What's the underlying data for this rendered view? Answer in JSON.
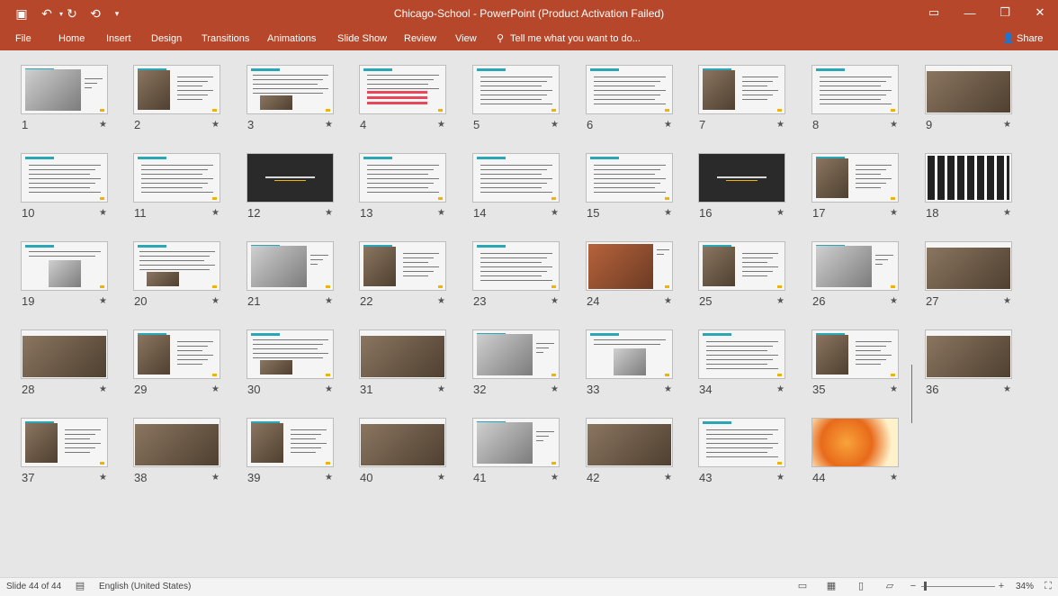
{
  "window": {
    "title": "Chicago-School - PowerPoint (Product Activation Failed)"
  },
  "quick_access": [
    {
      "name": "save-icon",
      "glyph": "💾"
    },
    {
      "name": "undo-icon",
      "glyph": "↶"
    },
    {
      "name": "redo-icon",
      "glyph": "↻"
    },
    {
      "name": "start-from-beginning-icon",
      "glyph": "⟲"
    },
    {
      "name": "customize-qat-icon",
      "glyph": "▾"
    }
  ],
  "ribbon": {
    "tabs": [
      "File",
      "Home",
      "Insert",
      "Design",
      "Transitions",
      "Animations",
      "Slide Show",
      "Review",
      "View"
    ],
    "tell_me": "Tell me what you want to do...",
    "share": "Share"
  },
  "slides": [
    {
      "n": "1",
      "type": "image-grey"
    },
    {
      "n": "2",
      "type": "image-left"
    },
    {
      "n": "3",
      "type": "text-image"
    },
    {
      "n": "4",
      "type": "text-red"
    },
    {
      "n": "5",
      "type": "text"
    },
    {
      "n": "6",
      "type": "text"
    },
    {
      "n": "7",
      "type": "image-left"
    },
    {
      "n": "8",
      "type": "text"
    },
    {
      "n": "9",
      "type": "image-full"
    },
    {
      "n": "10",
      "type": "text"
    },
    {
      "n": "11",
      "type": "text"
    },
    {
      "n": "12",
      "type": "dark"
    },
    {
      "n": "13",
      "type": "text"
    },
    {
      "n": "14",
      "type": "text"
    },
    {
      "n": "15",
      "type": "text"
    },
    {
      "n": "16",
      "type": "dark"
    },
    {
      "n": "17",
      "type": "image-left"
    },
    {
      "n": "18",
      "type": "image-bw"
    },
    {
      "n": "19",
      "type": "image-center"
    },
    {
      "n": "20",
      "type": "text-image"
    },
    {
      "n": "21",
      "type": "image-grey"
    },
    {
      "n": "22",
      "type": "image-left"
    },
    {
      "n": "23",
      "type": "text"
    },
    {
      "n": "24",
      "type": "image-warm"
    },
    {
      "n": "25",
      "type": "image-left"
    },
    {
      "n": "26",
      "type": "image-grey"
    },
    {
      "n": "27",
      "type": "image-full"
    },
    {
      "n": "28",
      "type": "image-full"
    },
    {
      "n": "29",
      "type": "image-left"
    },
    {
      "n": "30",
      "type": "text-image"
    },
    {
      "n": "31",
      "type": "image-full"
    },
    {
      "n": "32",
      "type": "image-grey"
    },
    {
      "n": "33",
      "type": "image-center"
    },
    {
      "n": "34",
      "type": "text"
    },
    {
      "n": "35",
      "type": "image-left"
    },
    {
      "n": "36",
      "type": "image-full"
    },
    {
      "n": "37",
      "type": "image-left"
    },
    {
      "n": "38",
      "type": "image-full"
    },
    {
      "n": "39",
      "type": "image-left"
    },
    {
      "n": "40",
      "type": "image-full"
    },
    {
      "n": "41",
      "type": "image-grey"
    },
    {
      "n": "42",
      "type": "image-full"
    },
    {
      "n": "43",
      "type": "text"
    },
    {
      "n": "44",
      "type": "image-orange"
    }
  ],
  "status": {
    "slide_info": "Slide 44 of 44",
    "language": "English (United States)",
    "zoom": "34%"
  },
  "colors": {
    "accent": "#b7472a",
    "teal": "#2aa6b5"
  }
}
